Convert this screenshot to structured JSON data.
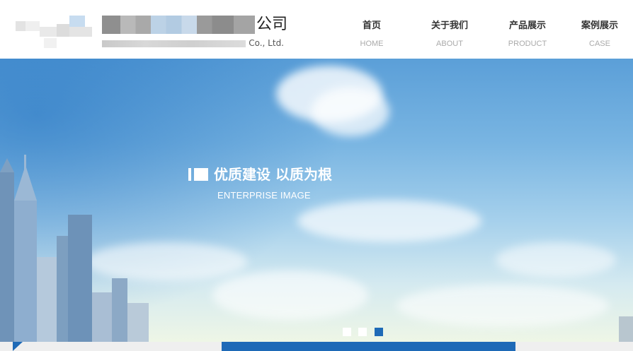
{
  "header": {
    "company_name_tail": "公司",
    "company_en_tail": "Co., Ltd."
  },
  "nav": [
    {
      "cn": "首页",
      "en": "HOME"
    },
    {
      "cn": "关于我们",
      "en": "ABOUT"
    },
    {
      "cn": "产品展示",
      "en": "PRODUCT"
    },
    {
      "cn": "案例展示",
      "en": "CASE"
    }
  ],
  "banner": {
    "title": "优质建设 以质为根",
    "subtitle": "ENTERPRISE IMAGE",
    "slides": [
      {
        "active": false
      },
      {
        "active": false
      },
      {
        "active": true
      }
    ]
  },
  "colors": {
    "accent": "#1e6ab7",
    "dot_inactive": "#ffffff",
    "nav_en": "#aaaaaa"
  }
}
